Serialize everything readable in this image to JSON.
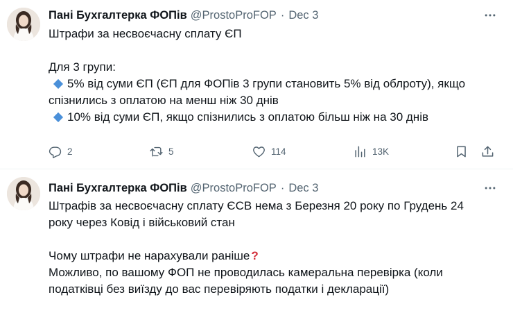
{
  "tweets": [
    {
      "author": {
        "name": "Пані Бухгалтерка ФОПів",
        "handle": "@ProstoProFOP",
        "separator": "·",
        "date": "Dec 3"
      },
      "lines": [
        "Штрафи за несвоєчасну сплату ЄП",
        "",
        "Для 3 групи:",
        "5% від суми ЄП (ЄП для ФОПів 3 групи становить 5% від облроту), якщо",
        "спізнились з оплатою на менш ніж 30 днів",
        "10% від суми ЄП, якщо спізнились з оплатою більш ніж на 30 днів"
      ],
      "stats": {
        "replies": "2",
        "retweets": "5",
        "likes": "114",
        "views": "13K"
      }
    },
    {
      "author": {
        "name": "Пані Бухгалтерка ФОПів",
        "handle": "@ProstoProFOP",
        "separator": "·",
        "date": "Dec 3"
      },
      "lines": [
        "Штрафів за несвоєчасну сплату ЄСВ нема з Березня 20 року по Грудень 24",
        "року через Ковід і військовий стан",
        "",
        "Чому штрафи не нарахували раніше",
        "Можливо, по вашому ФОП не проводилась камеральна перевірка (коли",
        "податківці без виїзду до вас перевіряють податки і декларації)"
      ],
      "question_mark": "?"
    }
  ],
  "icons": {
    "bullet": "large-blue-diamond-icon",
    "reply": "reply-icon",
    "retweet": "retweet-icon",
    "like": "heart-icon",
    "views": "views-icon",
    "bookmark": "bookmark-icon",
    "share": "share-icon",
    "more": "more-icon"
  },
  "colors": {
    "text": "#0f1419",
    "secondary": "#536471",
    "divider": "#eff3f4",
    "bullet": "#4a90d9",
    "question_mark": "#d32f3b"
  }
}
